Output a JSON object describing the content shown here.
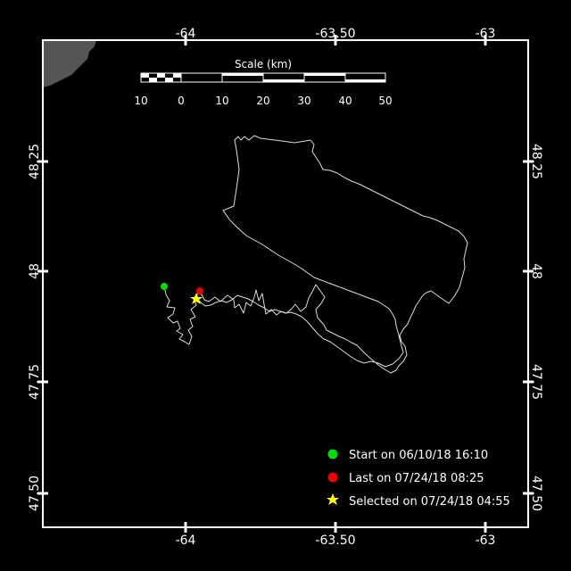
{
  "map": {
    "lon_ticks": [
      "-64",
      "-63.50",
      "-63"
    ],
    "lat_ticks": [
      "48.25",
      "48",
      "47.75",
      "47.50"
    ],
    "scale": {
      "title": "Scale (km)",
      "labels": [
        "10",
        "0",
        "10",
        "20",
        "30",
        "40",
        "50"
      ]
    },
    "legend": {
      "start": "Start on 06/10/18 16:10",
      "last": "Last on 07/24/18 08:25",
      "selected": "Selected on 07/24/18 04:55"
    },
    "colors": {
      "background": "#000000",
      "frame": "#ffffff",
      "land": "#555555",
      "track": "#dddddd",
      "start": "#00dd00",
      "last": "#ee0000",
      "selected": "#ffff00"
    },
    "icons": {
      "start": "green-circle",
      "last": "red-circle",
      "selected": "yellow-star"
    }
  }
}
